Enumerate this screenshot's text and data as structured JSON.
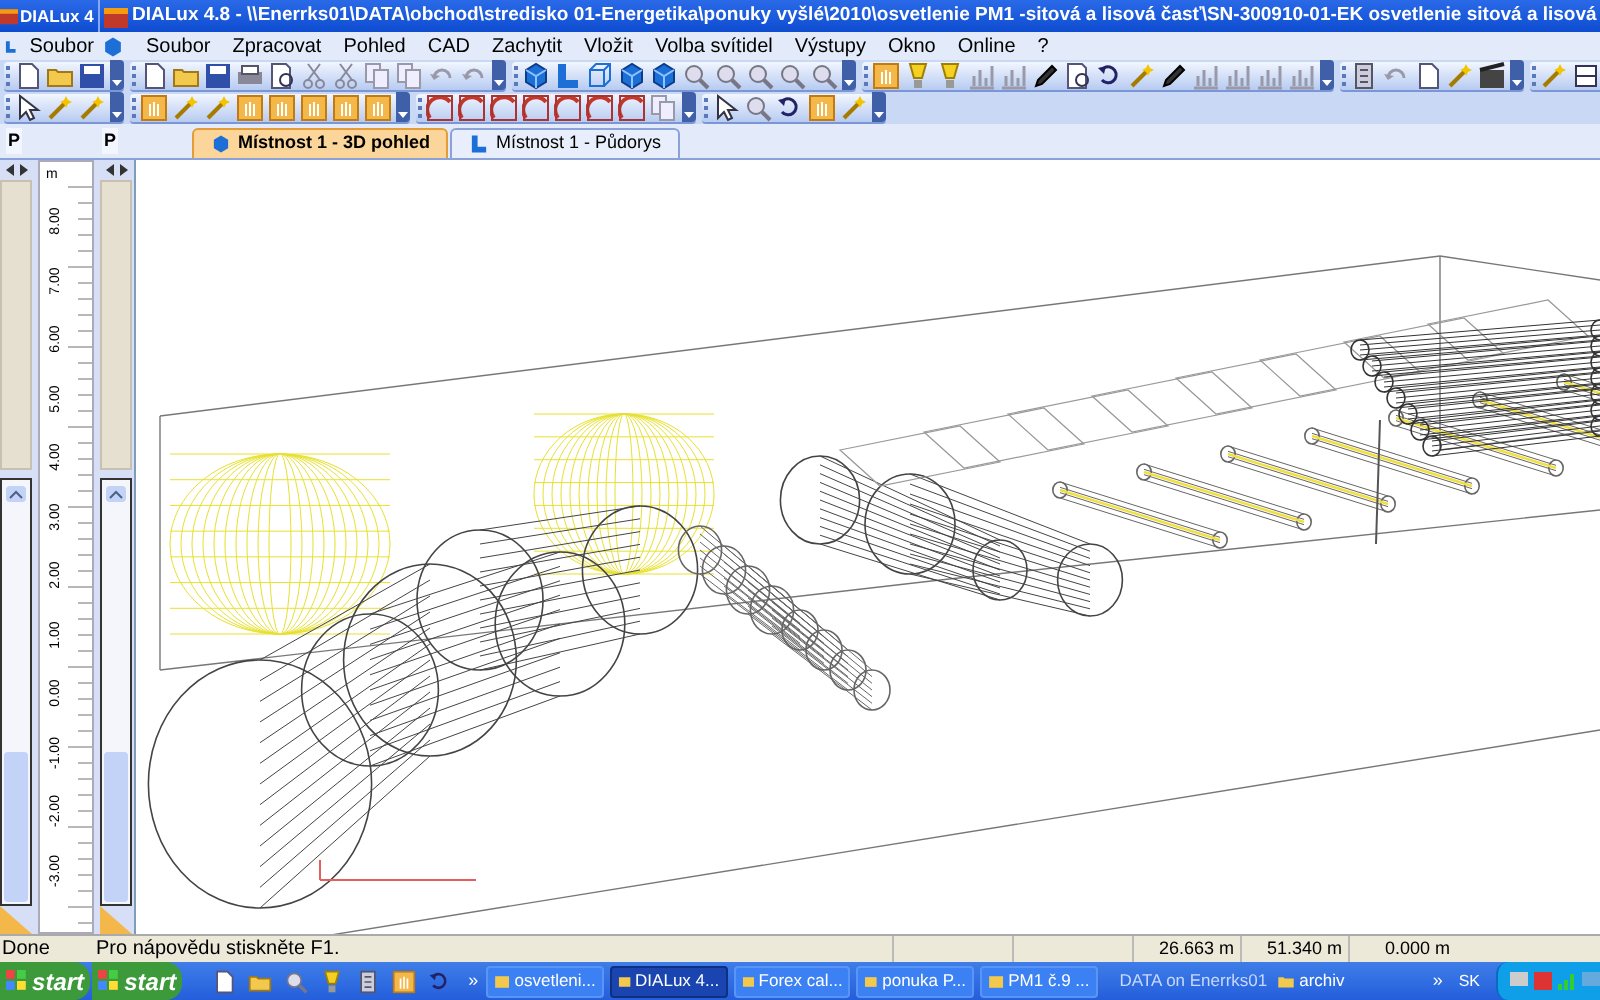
{
  "title_bar": {
    "background_window": "DIALux 4",
    "title": "DIALux 4.8 - \\\\Enerrks01\\DATA\\obchod\\stredisko 01-Energetika\\ponuky vyšlé\\2010\\osvetlenie PM1 -sitová a lisová časť\\SN-300910-01-EK osvetlenie sitová a lisová"
  },
  "menu_bar": {
    "left_menu": [
      "Soubor"
    ],
    "items": [
      "Soubor",
      "Zpracovat",
      "Pohled",
      "CAD",
      "Zachytit",
      "Vložit",
      "Volba svítidel",
      "Výstupy",
      "Okno",
      "Online",
      "?"
    ]
  },
  "panels": [
    {
      "label": "P"
    },
    {
      "label": "P"
    }
  ],
  "tabs": [
    {
      "label": "Místnost 1 - 3D pohled",
      "selected": true
    },
    {
      "label": "Místnost 1 - Půdorys",
      "selected": false
    }
  ],
  "ruler": {
    "unit": "m",
    "labels": [
      "8.00",
      "7.00",
      "6.00",
      "5.00",
      "4.00",
      "3.00",
      "2.00",
      "1.00",
      "0.00",
      "-1.00",
      "-2.00",
      "-3.00"
    ]
  },
  "status_bar": {
    "left": "Done",
    "message": "Pro nápovědu stiskněte F1.",
    "coordinates": [
      "26.663 m",
      "51.340 m",
      "0.000 m"
    ]
  },
  "taskbar": {
    "start_buttons": [
      "start",
      "start"
    ],
    "quick_launch_more": "»",
    "tasks": [
      {
        "label": "osvetleni...",
        "selected": false
      },
      {
        "label": "DIALux 4...",
        "selected": true
      },
      {
        "label": "Forex cal...",
        "selected": false
      },
      {
        "label": "ponuka P...",
        "selected": false
      },
      {
        "label": "PM1 č.9 ...",
        "selected": false
      }
    ],
    "address_band": "DATA on Enerrks01",
    "folder_band": "archiv",
    "tray_more": "»",
    "language": "SK"
  }
}
